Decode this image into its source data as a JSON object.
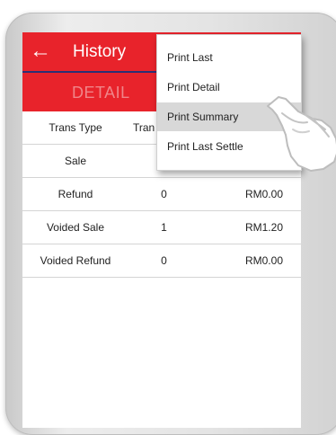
{
  "app_bar": {
    "title": "History",
    "back_icon": "arrow-left-icon",
    "color": "#e8232b"
  },
  "tab": {
    "label": "DETAIL"
  },
  "table": {
    "headers": [
      "Trans Type",
      "Tran"
    ],
    "rows": [
      {
        "type": "Sale",
        "count": "",
        "amount": ""
      },
      {
        "type": "Refund",
        "count": "0",
        "amount": "RM0.00"
      },
      {
        "type": "Voided Sale",
        "count": "1",
        "amount": "RM1.20"
      },
      {
        "type": "Voided Refund",
        "count": "0",
        "amount": "RM0.00"
      }
    ]
  },
  "menu": {
    "items": [
      "Print Last",
      "Print Detail",
      "Print Summary",
      "Print Last Settle"
    ],
    "highlighted_index": 2
  },
  "pointer_icon": "pointing-hand-icon"
}
